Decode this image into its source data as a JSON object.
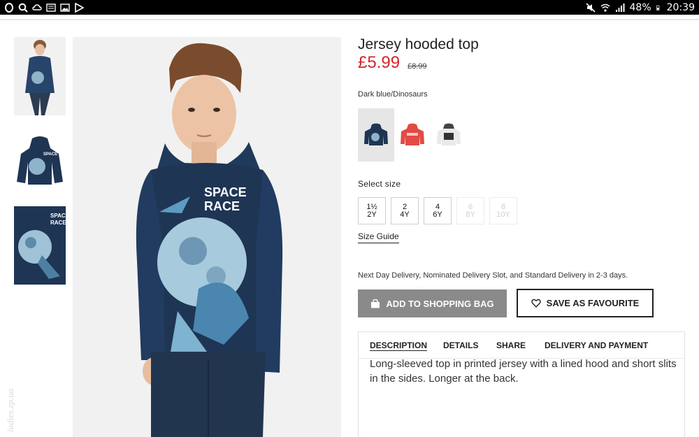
{
  "statusbar": {
    "battery": "48%",
    "time": "20:39"
  },
  "product": {
    "title": "Jersey hooded top",
    "price": "£5.99",
    "old_price": "£8.99",
    "color_name": "Dark blue/Dinosaurs",
    "print_text": "SPACE RACE",
    "swatches": [
      {
        "name": "Dark blue/Dinosaurs",
        "color": "#1e3554",
        "selected": true
      },
      {
        "name": "Red",
        "color": "#e34a45",
        "selected": false
      },
      {
        "name": "White",
        "color": "#e9e9e9",
        "selected": false
      }
    ],
    "select_size_label": "Select size",
    "sizes": [
      {
        "top": "1½",
        "bottom": "2Y",
        "available": true
      },
      {
        "top": "2",
        "bottom": "4Y",
        "available": true
      },
      {
        "top": "4",
        "bottom": "6Y",
        "available": true
      },
      {
        "top": "6",
        "bottom": "8Y",
        "available": false
      },
      {
        "top": "8",
        "bottom": "10Y",
        "available": false
      }
    ],
    "size_guide": "Size Guide",
    "delivery_text": "Next Day Delivery, Nominated Delivery Slot, and Standard Delivery in 2-3 days.",
    "add_to_bag": "ADD TO SHOPPING BAG",
    "save_favourite": "SAVE AS FAVOURITE",
    "tabs": [
      "DESCRIPTION",
      "DETAILS",
      "SHARE",
      "DELIVERY AND PAYMENT"
    ],
    "description": "Long-sleeved top in printed jersey with a lined hood and short slits in the sides. Longer at the back."
  },
  "watermark": "ladies.zp.ua",
  "colors": {
    "price_red": "#d4262d",
    "hoodie_navy": "#1e3554",
    "button_grey": "#8a8a8a"
  }
}
